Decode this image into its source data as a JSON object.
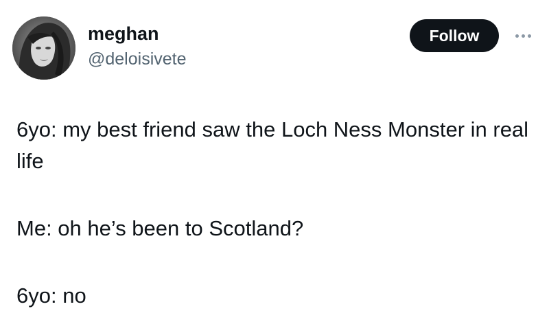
{
  "author": {
    "display_name": "meghan",
    "handle": "@deloisivete",
    "avatar_icon": "profile-photo"
  },
  "actions": {
    "follow_label": "Follow",
    "more_icon": "more-horizontal-icon"
  },
  "tweet": {
    "paragraphs": [
      "6yo: my best friend saw the Loch Ness Monster in real life",
      "Me: oh he’s been to Scotland?",
      "6yo: no"
    ]
  },
  "colors": {
    "text": "#0f1419",
    "secondary_text": "#536471",
    "follow_button_bg": "#0f1419",
    "follow_button_text": "#ffffff",
    "more_dots": "#8b98a5"
  }
}
